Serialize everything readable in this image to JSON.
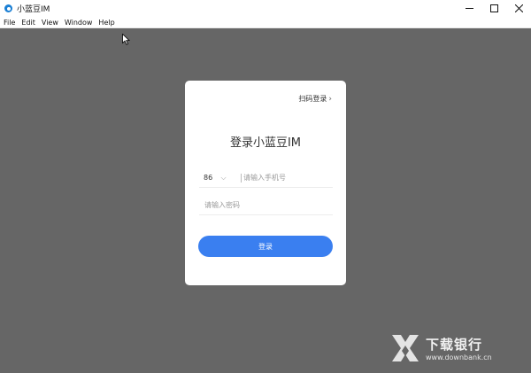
{
  "window": {
    "title": "小蓝豆IM",
    "icon": "app-logo-icon",
    "accent": "#1a7fd4"
  },
  "menu": {
    "items": [
      "File",
      "Edit",
      "View",
      "Window",
      "Help"
    ]
  },
  "login": {
    "qr_link": "扫码登录",
    "title": "登录小蓝豆IM",
    "country_code": "86",
    "phone_placeholder": "请输入手机号",
    "password_placeholder": "请输入密码",
    "submit_label": "登录",
    "button_color": "#3a7ff0"
  },
  "watermark": {
    "name": "下载银行",
    "url": "www.downbank.cn"
  }
}
